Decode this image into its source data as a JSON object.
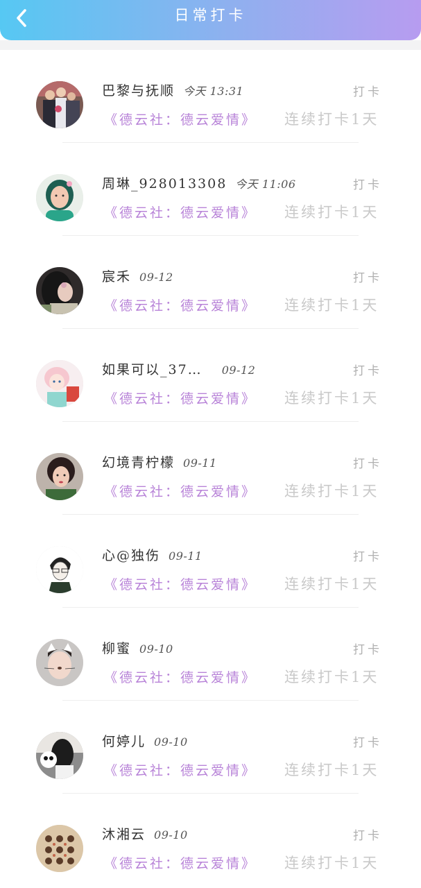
{
  "header": {
    "title": "日常打卡",
    "back_icon": "chevron-left-icon",
    "gradient_start": "#56c8f3",
    "gradient_end": "#b79cf0"
  },
  "colors": {
    "book_text": "#b883d8",
    "streak_text": "#c9c9c9",
    "action_text": "#b0b0b0"
  },
  "checkins": [
    {
      "name": "巴黎与抚顺",
      "time": "今天 13:31",
      "action": "打卡",
      "book": "《德云社：德云爱情》",
      "streak": "连续打卡1天",
      "avatar": "group-photo-avatar"
    },
    {
      "name": "周琳_928013308",
      "time": "今天 11:06",
      "action": "打卡",
      "book": "《德云社：德云爱情》",
      "streak": "连续打卡1天",
      "avatar": "woman-portrait-avatar"
    },
    {
      "name": "宸禾",
      "time": "09-12",
      "action": "打卡",
      "book": "《德云社：德云爱情》",
      "streak": "连续打卡1天",
      "avatar": "woman-profile-avatar"
    },
    {
      "name": "如果可以_37…",
      "time": "09-12",
      "action": "打卡",
      "book": "《德云社：德云爱情》",
      "streak": "连续打卡1天",
      "avatar": "anime-girl-avatar"
    },
    {
      "name": "幻境青柠檬",
      "time": "09-11",
      "action": "打卡",
      "book": "《德云社：德云爱情》",
      "streak": "连续打卡1天",
      "avatar": "woman-selfie-avatar"
    },
    {
      "name": "心@独伤",
      "time": "09-11",
      "action": "打卡",
      "book": "《德云社：德云爱情》",
      "streak": "连续打卡1天",
      "avatar": "sketch-boy-avatar"
    },
    {
      "name": "柳蜜",
      "time": "09-10",
      "action": "打卡",
      "book": "《德云社：德云爱情》",
      "streak": "连续打卡1天",
      "avatar": "cat-filter-avatar"
    },
    {
      "name": "何婷儿",
      "time": "09-10",
      "action": "打卡",
      "book": "《德云社：德云爱情》",
      "streak": "连续打卡1天",
      "avatar": "panda-photo-avatar"
    },
    {
      "name": "沐湘云",
      "time": "09-10",
      "action": "打卡",
      "book": "《德云社：德云爱情》",
      "streak": "连续打卡1天",
      "avatar": "bear-pattern-avatar"
    }
  ]
}
